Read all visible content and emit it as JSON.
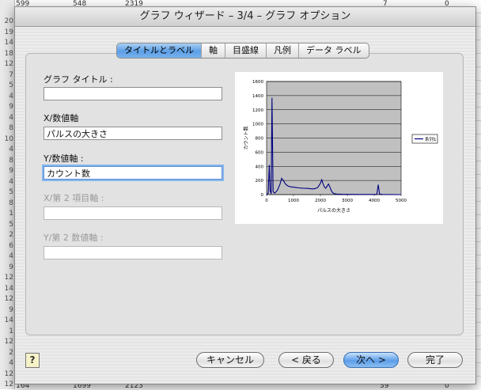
{
  "sheet": {
    "row_numbers": [
      "20",
      "19",
      "14",
      "18",
      "12",
      "7",
      "5",
      "4",
      "9",
      "4",
      "8",
      "10",
      "4",
      "8",
      "9",
      "4",
      "5",
      "8",
      "1",
      "5",
      "2",
      "6",
      "4",
      "9",
      "12",
      "14",
      "12",
      "9",
      "14",
      "1",
      "12",
      "2",
      "4",
      "12",
      "12"
    ],
    "top_cells": [
      "599",
      "548",
      "2319",
      "7",
      "0"
    ],
    "bottom_cells": [
      "164",
      "1699",
      "2123",
      "39",
      "0"
    ]
  },
  "dialog": {
    "title": "グラフ ウィザード – 3/4 – グラフ オプション",
    "tabs": [
      {
        "label": "タイトルとラベル",
        "active": true
      },
      {
        "label": "軸",
        "active": false
      },
      {
        "label": "目盛線",
        "active": false
      },
      {
        "label": "凡例",
        "active": false
      },
      {
        "label": "データ ラベル",
        "active": false
      }
    ],
    "fields": {
      "chart_title": {
        "label": "グラフ タイトル :",
        "value": ""
      },
      "x_axis": {
        "label": "X/数値軸",
        "value": "パルスの大きさ"
      },
      "y_axis": {
        "label": "Y/数値軸 :",
        "value": "カウント数"
      },
      "x2_axis": {
        "label": "X/第 2 項目軸 :",
        "value": ""
      },
      "y2_axis": {
        "label": "Y/第 2 数値軸 :",
        "value": ""
      }
    },
    "buttons": {
      "help": "?",
      "cancel": "キャンセル",
      "back": "< 戻る",
      "next": "次へ >",
      "finish": "完了"
    }
  },
  "chart_data": {
    "type": "line",
    "xlabel": "パルスの大きさ",
    "ylabel": "カウント数",
    "legend_label": "系列1",
    "legend_position": "right",
    "xlim": [
      0,
      5000
    ],
    "ylim": [
      0,
      1600
    ],
    "x_ticks": [
      "0",
      "1000",
      "2000",
      "3000",
      "4000",
      "5000"
    ],
    "y_ticks": [
      "0",
      "200",
      "400",
      "600",
      "800",
      "1000",
      "1200",
      "1400",
      "1600"
    ],
    "grid": true,
    "plot_background": "#c0c0c0",
    "line_color": "#000080",
    "series": [
      {
        "points": [
          [
            0,
            0
          ],
          [
            60,
            20
          ],
          [
            100,
            420
          ],
          [
            130,
            60
          ],
          [
            170,
            10
          ],
          [
            200,
            1370
          ],
          [
            240,
            40
          ],
          [
            300,
            20
          ],
          [
            400,
            60
          ],
          [
            500,
            150
          ],
          [
            560,
            230
          ],
          [
            620,
            200
          ],
          [
            700,
            150
          ],
          [
            800,
            120
          ],
          [
            900,
            110
          ],
          [
            1000,
            105
          ],
          [
            1100,
            100
          ],
          [
            1200,
            95
          ],
          [
            1300,
            92
          ],
          [
            1400,
            90
          ],
          [
            1500,
            88
          ],
          [
            1600,
            85
          ],
          [
            1700,
            80
          ],
          [
            1800,
            85
          ],
          [
            1900,
            100
          ],
          [
            2000,
            160
          ],
          [
            2050,
            210
          ],
          [
            2100,
            150
          ],
          [
            2150,
            110
          ],
          [
            2200,
            90
          ],
          [
            2250,
            120
          ],
          [
            2300,
            150
          ],
          [
            2350,
            110
          ],
          [
            2400,
            60
          ],
          [
            2450,
            30
          ],
          [
            2500,
            15
          ],
          [
            2600,
            8
          ],
          [
            2800,
            5
          ],
          [
            3000,
            3
          ],
          [
            3500,
            2
          ],
          [
            4000,
            2
          ],
          [
            4100,
            5
          ],
          [
            4150,
            140
          ],
          [
            4200,
            8
          ],
          [
            4300,
            2
          ],
          [
            4600,
            1
          ],
          [
            5000,
            0
          ]
        ]
      }
    ]
  }
}
